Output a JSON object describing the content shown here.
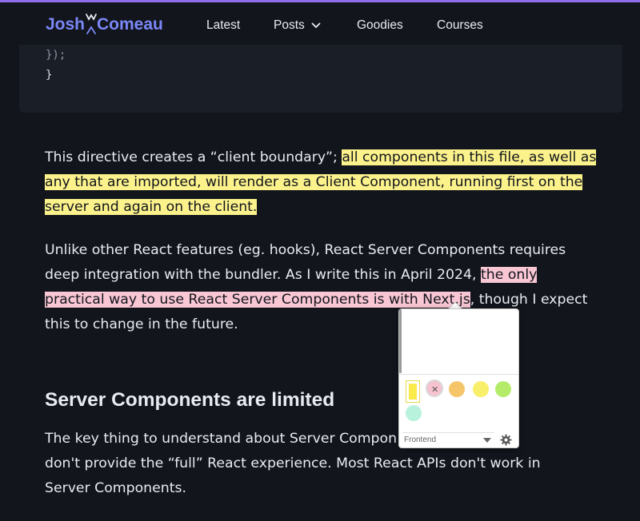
{
  "header": {
    "logo_left": "Josh",
    "logo_right": "Comeau",
    "nav": [
      {
        "label": "Latest"
      },
      {
        "label": "Posts"
      },
      {
        "label": "Goodies"
      },
      {
        "label": "Courses"
      }
    ]
  },
  "code": {
    "line1": "});",
    "line2": "}"
  },
  "paragraph1": {
    "plain": "This directive creates a “client boundary”; ",
    "highlight_line1": "all components in this file, as well as",
    "highlight_line2": "any that are imported, will render as a Client Component, running first on the",
    "highlight_line3": "server and again on the client."
  },
  "paragraph2": {
    "line1": "Unlike other React features (eg. hooks), React Server Components requires",
    "line2_plain": "deep integration with the bundler. As I write this in April 2024, ",
    "line2_highlight": "the only",
    "line3_highlight": "practical way to use React Server Components is with Next.js",
    "line3_plain": ", though I expect",
    "line4": "this to change in the future."
  },
  "heading": "Server Components are limited",
  "paragraph3": {
    "line1": "The key thing to understand about Server Compon",
    "line2": "don't provide the “full” React experience. Most React APIs don't work in",
    "line3": "Server Components."
  },
  "popup": {
    "select_value": "Frontend",
    "swatches": [
      {
        "color": "#f7c2cf",
        "selected": true
      },
      {
        "color": "#f6c56a",
        "selected": false
      },
      {
        "color": "#f8ef6a",
        "selected": false
      },
      {
        "color": "#b4ec6a",
        "selected": false
      },
      {
        "color": "#b8f1dc",
        "selected": false
      }
    ]
  },
  "colors": {
    "accent": "#8e6ee8",
    "logo": "#7b88f8",
    "background": "#12151c",
    "highlight_yellow": "#fcf28c",
    "highlight_pink": "#f9c6d4"
  }
}
